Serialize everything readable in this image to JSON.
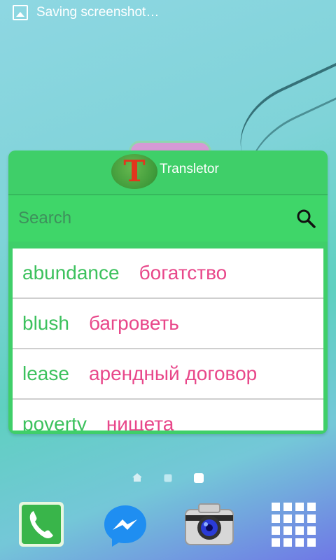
{
  "status_bar": {
    "notification_text": "Saving screenshot…"
  },
  "widget": {
    "logo_letter": "T",
    "app_title": "Transletor",
    "search": {
      "placeholder": "Search",
      "value": ""
    },
    "entries": [
      {
        "word": "abundance",
        "translation": "богатство"
      },
      {
        "word": "blush",
        "translation": "багроветь"
      },
      {
        "word": "lease",
        "translation": "арендный договор"
      },
      {
        "word": "poverty",
        "translation": "нищета"
      }
    ]
  },
  "page_indicator": {
    "pages": 3,
    "active_page": 3
  },
  "dock": {
    "icons": [
      "phone-icon",
      "messenger-icon",
      "camera-icon",
      "apps-grid-icon"
    ]
  },
  "colors": {
    "widget_green": "#3fcf69",
    "word_green": "#3cc15d",
    "translation_pink": "#e8478a",
    "logo_red": "#e2361d"
  }
}
